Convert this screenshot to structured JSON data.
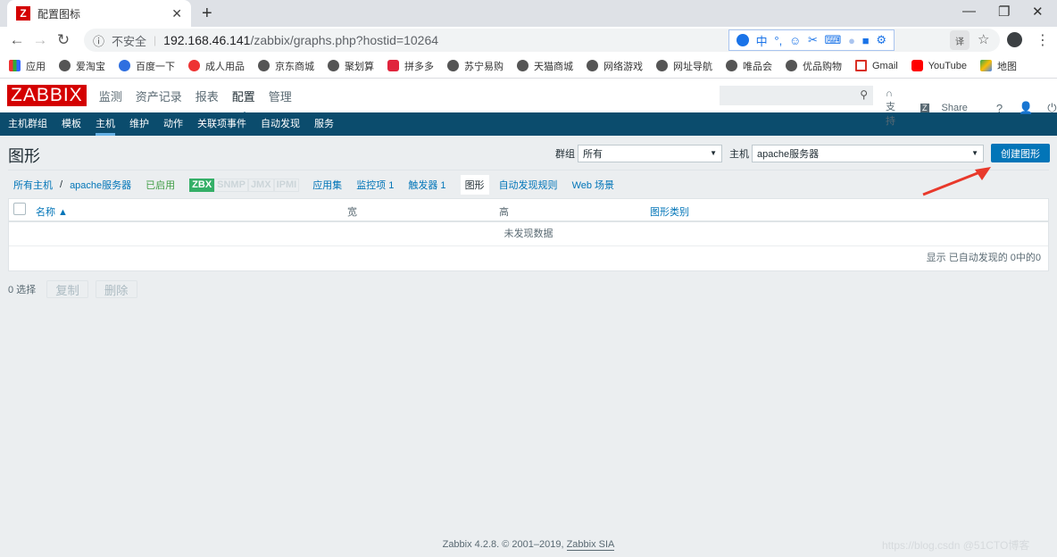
{
  "browser": {
    "tab_title": "配置图标",
    "tab_favicon": "Z",
    "new_tab_icon": "+",
    "insecure_label": "不安全",
    "url_host": "192.168.46.141",
    "url_path": "/zabbix/graphs.php?hostid=10264",
    "ime_icons": [
      "user-icon",
      "中",
      "°,",
      "☺",
      "✂",
      "⌨",
      "person-icon",
      "shirt-icon",
      "gear-icon"
    ],
    "bookmarks": [
      {
        "label": "应用",
        "icon": "apps-icon"
      },
      {
        "label": "爱淘宝",
        "icon": "globe-icon"
      },
      {
        "label": "百度一下",
        "icon": "baidu-icon"
      },
      {
        "label": "成人用品",
        "icon": "heart-icon"
      },
      {
        "label": "京东商城",
        "icon": "globe-icon"
      },
      {
        "label": "聚划算",
        "icon": "globe-icon"
      },
      {
        "label": "拼多多",
        "icon": "pinduoduo-icon"
      },
      {
        "label": "苏宁易购",
        "icon": "globe-icon"
      },
      {
        "label": "天猫商城",
        "icon": "globe-icon"
      },
      {
        "label": "网络游戏",
        "icon": "globe-icon"
      },
      {
        "label": "网址导航",
        "icon": "globe-icon"
      },
      {
        "label": "唯品会",
        "icon": "globe-icon"
      },
      {
        "label": "优品购物",
        "icon": "globe-icon"
      },
      {
        "label": "Gmail",
        "icon": "gmail-icon"
      },
      {
        "label": "YouTube",
        "icon": "youtube-icon"
      },
      {
        "label": "地图",
        "icon": "maps-icon"
      }
    ]
  },
  "header": {
    "logo": "ZABBIX",
    "main_nav": [
      "监测",
      "资产记录",
      "报表",
      "配置",
      "管理"
    ],
    "active_main": "配置",
    "search_placeholder": "",
    "support": "支持",
    "share": "Share",
    "share_badge": "Z",
    "help": "?"
  },
  "subnav": {
    "items": [
      "主机群组",
      "模板",
      "主机",
      "维护",
      "动作",
      "关联项事件",
      "自动发现",
      "服务"
    ],
    "active": "主机"
  },
  "page": {
    "title": "图形",
    "filter_group_label": "群组",
    "filter_group_value": "所有",
    "filter_host_label": "主机",
    "filter_host_value": "apache服务器",
    "create_button": "创建图形"
  },
  "hostnav": {
    "all_hosts": "所有主机",
    "separator": "/",
    "host": "apache服务器",
    "status": "已启用",
    "availability": [
      "ZBX",
      "SNMP",
      "JMX",
      "IPMI"
    ],
    "tabs": [
      {
        "label": "应用集"
      },
      {
        "label": "监控项 1"
      },
      {
        "label": "触发器 1"
      },
      {
        "label": "图形",
        "selected": true
      },
      {
        "label": "自动发现规则"
      },
      {
        "label": "Web 场景"
      }
    ]
  },
  "table": {
    "columns": [
      "名称 ▲",
      "宽",
      "高",
      "图形类别"
    ],
    "empty_message": "未发现数据",
    "footer": "显示 已自动发现的 0中的0"
  },
  "actions": {
    "selected": "0 选择",
    "copy": "复制",
    "delete": "删除"
  },
  "footer": {
    "text": "Zabbix 4.2.8. © 2001–2019, ",
    "link": "Zabbix SIA",
    "watermark": "https://blog.csdn @51CTO博客"
  },
  "colors": {
    "brand_red": "#d40000",
    "nav_blue": "#0b4c6d",
    "link_blue": "#0275b8",
    "zbx_green": "#34af67",
    "enabled_green": "#429e47"
  }
}
